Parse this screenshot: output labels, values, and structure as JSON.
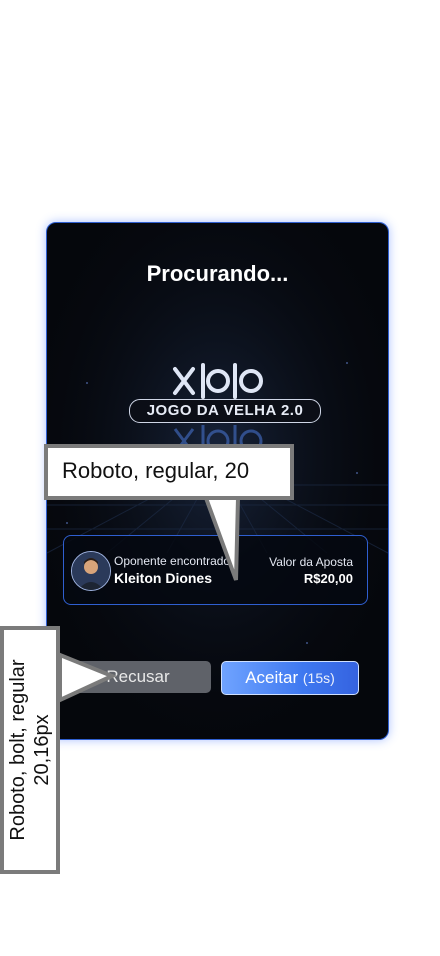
{
  "modal": {
    "title": "Procurando...",
    "logo": {
      "text": "JOGO DA VELHA 2.0",
      "mark": "XOO"
    }
  },
  "opponent": {
    "label": "Oponente encontrado",
    "name": "Kleiton Diones",
    "bet_label": "Valor da Aposta",
    "bet_value": "R$20,00"
  },
  "buttons": {
    "reject_label": "Recusar",
    "accept_label": "Aceitar",
    "accept_timer": "(15s)"
  },
  "annotations": {
    "callout_1": "Roboto, regular, 20",
    "callout_2": "Roboto, bolt, regular 20,16px"
  },
  "colors": {
    "modal_bg": "#05070c",
    "accent_border": "#2f5fd0",
    "accept_gradient_start": "#6fa3ff",
    "accept_gradient_end": "#3563e0",
    "reject_bg": "#5f6269",
    "annotation_border": "#7b7b7b"
  }
}
